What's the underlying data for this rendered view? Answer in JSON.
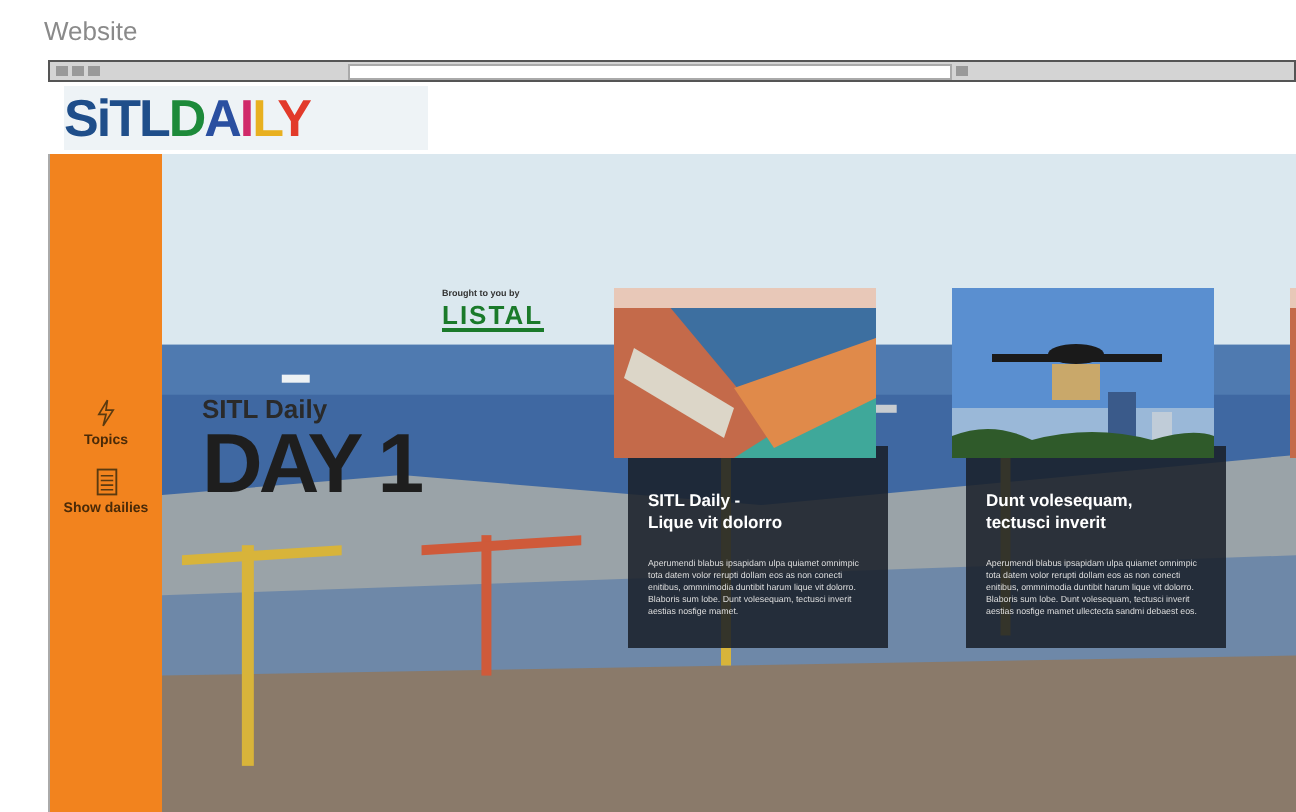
{
  "page_title": "Website",
  "logo": {
    "part_1": "SiTL",
    "part_2": "DAILY"
  },
  "sidebar": {
    "items": [
      {
        "label": "Topics"
      },
      {
        "label": "Show dailies"
      }
    ]
  },
  "hero": {
    "sponsor_label": "Brought to you by",
    "sponsor": "LISTAL",
    "kicker": "SITL Daily",
    "title": "DAY 1"
  },
  "cards": [
    {
      "image": {
        "kind": "picture"
      },
      "title": "SITL Daily -\nLique vit dolorro",
      "body": "Aperumendi blabus ipsapidam ulpa quiamet omnimpic tota datem volor rerupti dollam eos as non conecti enitibus, ommnimodia duntibit harum lique vit dolorro. Blaboris sum lobe. Dunt volesequam, tectusci inverit aestias nosfige mamet."
    },
    {
      "image": {
        "kind": "picture"
      },
      "title": "Dunt volesequam,\ntectusci inverit",
      "body": "Aperumendi blabus ipsapidam ulpa quiamet omnimpic tota datem volor rerupti dollam eos as non conecti enitibus, ommnimodia duntibit harum lique vit dolorro. Blaboris sum lobe. Dunt volesequam, tectusci inverit aestias nosfige mamet ullectecta sandmi debaest eos."
    },
    {
      "image": {
        "kind": "picture"
      }
    }
  ]
}
